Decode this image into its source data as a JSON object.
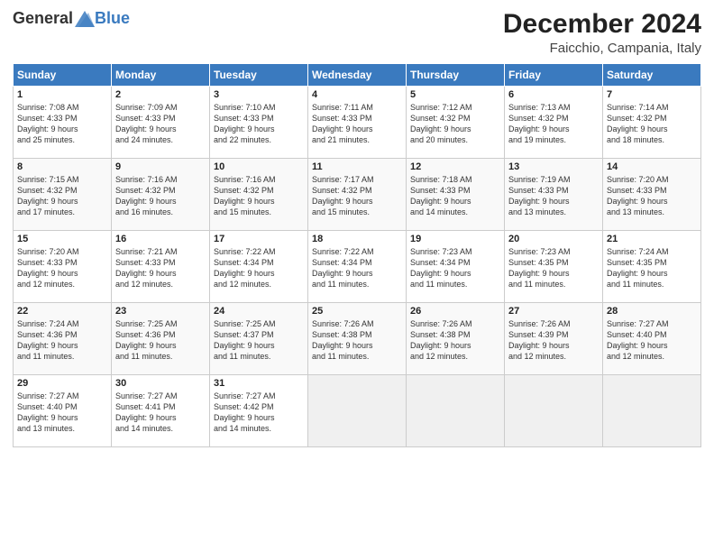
{
  "header": {
    "logo_general": "General",
    "logo_blue": "Blue",
    "month": "December 2024",
    "location": "Faicchio, Campania, Italy"
  },
  "columns": [
    "Sunday",
    "Monday",
    "Tuesday",
    "Wednesday",
    "Thursday",
    "Friday",
    "Saturday"
  ],
  "weeks": [
    [
      {
        "day": "1",
        "lines": [
          "Sunrise: 7:08 AM",
          "Sunset: 4:33 PM",
          "Daylight: 9 hours",
          "and 25 minutes."
        ]
      },
      {
        "day": "2",
        "lines": [
          "Sunrise: 7:09 AM",
          "Sunset: 4:33 PM",
          "Daylight: 9 hours",
          "and 24 minutes."
        ]
      },
      {
        "day": "3",
        "lines": [
          "Sunrise: 7:10 AM",
          "Sunset: 4:33 PM",
          "Daylight: 9 hours",
          "and 22 minutes."
        ]
      },
      {
        "day": "4",
        "lines": [
          "Sunrise: 7:11 AM",
          "Sunset: 4:33 PM",
          "Daylight: 9 hours",
          "and 21 minutes."
        ]
      },
      {
        "day": "5",
        "lines": [
          "Sunrise: 7:12 AM",
          "Sunset: 4:32 PM",
          "Daylight: 9 hours",
          "and 20 minutes."
        ]
      },
      {
        "day": "6",
        "lines": [
          "Sunrise: 7:13 AM",
          "Sunset: 4:32 PM",
          "Daylight: 9 hours",
          "and 19 minutes."
        ]
      },
      {
        "day": "7",
        "lines": [
          "Sunrise: 7:14 AM",
          "Sunset: 4:32 PM",
          "Daylight: 9 hours",
          "and 18 minutes."
        ]
      }
    ],
    [
      {
        "day": "8",
        "lines": [
          "Sunrise: 7:15 AM",
          "Sunset: 4:32 PM",
          "Daylight: 9 hours",
          "and 17 minutes."
        ]
      },
      {
        "day": "9",
        "lines": [
          "Sunrise: 7:16 AM",
          "Sunset: 4:32 PM",
          "Daylight: 9 hours",
          "and 16 minutes."
        ]
      },
      {
        "day": "10",
        "lines": [
          "Sunrise: 7:16 AM",
          "Sunset: 4:32 PM",
          "Daylight: 9 hours",
          "and 15 minutes."
        ]
      },
      {
        "day": "11",
        "lines": [
          "Sunrise: 7:17 AM",
          "Sunset: 4:32 PM",
          "Daylight: 9 hours",
          "and 15 minutes."
        ]
      },
      {
        "day": "12",
        "lines": [
          "Sunrise: 7:18 AM",
          "Sunset: 4:33 PM",
          "Daylight: 9 hours",
          "and 14 minutes."
        ]
      },
      {
        "day": "13",
        "lines": [
          "Sunrise: 7:19 AM",
          "Sunset: 4:33 PM",
          "Daylight: 9 hours",
          "and 13 minutes."
        ]
      },
      {
        "day": "14",
        "lines": [
          "Sunrise: 7:20 AM",
          "Sunset: 4:33 PM",
          "Daylight: 9 hours",
          "and 13 minutes."
        ]
      }
    ],
    [
      {
        "day": "15",
        "lines": [
          "Sunrise: 7:20 AM",
          "Sunset: 4:33 PM",
          "Daylight: 9 hours",
          "and 12 minutes."
        ]
      },
      {
        "day": "16",
        "lines": [
          "Sunrise: 7:21 AM",
          "Sunset: 4:33 PM",
          "Daylight: 9 hours",
          "and 12 minutes."
        ]
      },
      {
        "day": "17",
        "lines": [
          "Sunrise: 7:22 AM",
          "Sunset: 4:34 PM",
          "Daylight: 9 hours",
          "and 12 minutes."
        ]
      },
      {
        "day": "18",
        "lines": [
          "Sunrise: 7:22 AM",
          "Sunset: 4:34 PM",
          "Daylight: 9 hours",
          "and 11 minutes."
        ]
      },
      {
        "day": "19",
        "lines": [
          "Sunrise: 7:23 AM",
          "Sunset: 4:34 PM",
          "Daylight: 9 hours",
          "and 11 minutes."
        ]
      },
      {
        "day": "20",
        "lines": [
          "Sunrise: 7:23 AM",
          "Sunset: 4:35 PM",
          "Daylight: 9 hours",
          "and 11 minutes."
        ]
      },
      {
        "day": "21",
        "lines": [
          "Sunrise: 7:24 AM",
          "Sunset: 4:35 PM",
          "Daylight: 9 hours",
          "and 11 minutes."
        ]
      }
    ],
    [
      {
        "day": "22",
        "lines": [
          "Sunrise: 7:24 AM",
          "Sunset: 4:36 PM",
          "Daylight: 9 hours",
          "and 11 minutes."
        ]
      },
      {
        "day": "23",
        "lines": [
          "Sunrise: 7:25 AM",
          "Sunset: 4:36 PM",
          "Daylight: 9 hours",
          "and 11 minutes."
        ]
      },
      {
        "day": "24",
        "lines": [
          "Sunrise: 7:25 AM",
          "Sunset: 4:37 PM",
          "Daylight: 9 hours",
          "and 11 minutes."
        ]
      },
      {
        "day": "25",
        "lines": [
          "Sunrise: 7:26 AM",
          "Sunset: 4:38 PM",
          "Daylight: 9 hours",
          "and 11 minutes."
        ]
      },
      {
        "day": "26",
        "lines": [
          "Sunrise: 7:26 AM",
          "Sunset: 4:38 PM",
          "Daylight: 9 hours",
          "and 12 minutes."
        ]
      },
      {
        "day": "27",
        "lines": [
          "Sunrise: 7:26 AM",
          "Sunset: 4:39 PM",
          "Daylight: 9 hours",
          "and 12 minutes."
        ]
      },
      {
        "day": "28",
        "lines": [
          "Sunrise: 7:27 AM",
          "Sunset: 4:40 PM",
          "Daylight: 9 hours",
          "and 12 minutes."
        ]
      }
    ],
    [
      {
        "day": "29",
        "lines": [
          "Sunrise: 7:27 AM",
          "Sunset: 4:40 PM",
          "Daylight: 9 hours",
          "and 13 minutes."
        ]
      },
      {
        "day": "30",
        "lines": [
          "Sunrise: 7:27 AM",
          "Sunset: 4:41 PM",
          "Daylight: 9 hours",
          "and 14 minutes."
        ]
      },
      {
        "day": "31",
        "lines": [
          "Sunrise: 7:27 AM",
          "Sunset: 4:42 PM",
          "Daylight: 9 hours",
          "and 14 minutes."
        ]
      },
      null,
      null,
      null,
      null
    ]
  ]
}
